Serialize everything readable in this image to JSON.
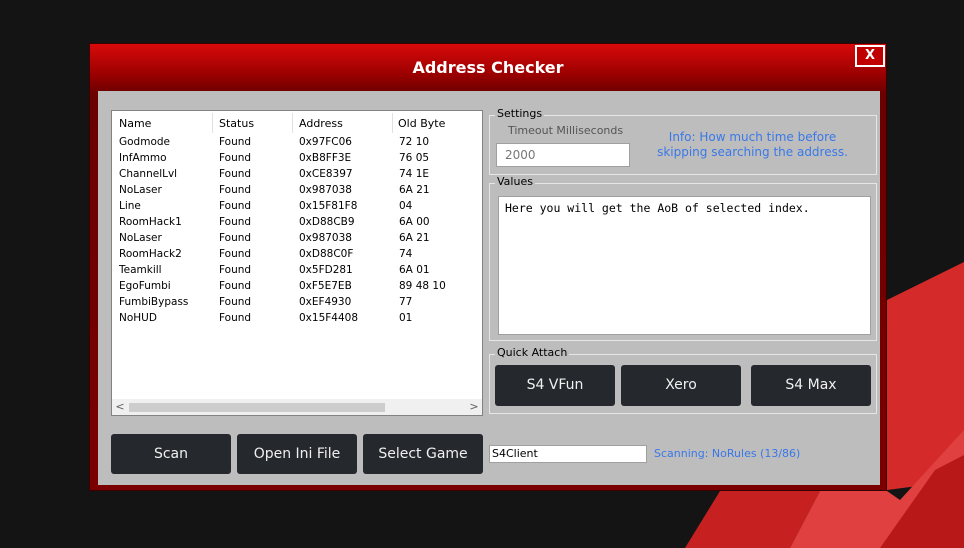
{
  "window": {
    "title": "Address Checker",
    "close_label": "X"
  },
  "list": {
    "columns": [
      "Name",
      "Status",
      "Address",
      "Old Byte"
    ],
    "rows": [
      [
        "Godmode",
        "Found",
        "0x97FC06",
        "72 10"
      ],
      [
        "InfAmmo",
        "Found",
        "0xB8FF3E",
        "76 05"
      ],
      [
        "ChannelLvl",
        "Found",
        "0xCE8397",
        "74 1E"
      ],
      [
        "NoLaser",
        "Found",
        "0x987038",
        "6A 21"
      ],
      [
        "Line",
        "Found",
        "0x15F81F8",
        "04"
      ],
      [
        "RoomHack1",
        "Found",
        "0xD88CB9",
        "6A 00"
      ],
      [
        "NoLaser",
        "Found",
        "0x987038",
        "6A 21"
      ],
      [
        "RoomHack2",
        "Found",
        "0xD88C0F",
        "74"
      ],
      [
        "Teamkill",
        "Found",
        "0x5FD281",
        "6A 01"
      ],
      [
        "EgoFumbi",
        "Found",
        "0xF5E7EB",
        "89 48 10"
      ],
      [
        "FumbiBypass",
        "Found",
        "0xEF4930",
        "77"
      ],
      [
        "NoHUD",
        "Found",
        "0x15F4408",
        "01"
      ]
    ],
    "scroll_left": "<",
    "scroll_right": ">"
  },
  "settings": {
    "group_label": "Settings",
    "timeout_label": "Timeout Milliseconds",
    "timeout_value": "2000",
    "info_line1": "Info: How much time before",
    "info_line2": "skipping searching the address."
  },
  "values": {
    "group_label": "Values",
    "text": "Here you will get the AoB of selected index."
  },
  "quick_attach": {
    "group_label": "Quick Attach",
    "buttons": [
      "S4 VFun",
      "Xero",
      "S4 Max"
    ]
  },
  "bottom": {
    "scan": "Scan",
    "open_ini": "Open Ini File",
    "select_game": "Select Game",
    "process_value": "S4Client",
    "status": "Scanning: NoRules (13/86)"
  },
  "colors": {
    "background": "#141414",
    "accent_red": "#c00000",
    "info_blue": "#3a78e8",
    "button_dark": "#25282c",
    "client_gray": "#bdbdbd"
  }
}
